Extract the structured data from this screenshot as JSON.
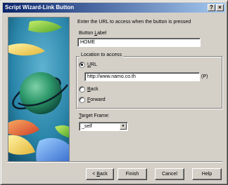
{
  "window": {
    "title": "Script Wizard-Link Button",
    "help_glyph": "?",
    "close_glyph": "×"
  },
  "intro_text": "Enter the URL to access when the button is pressed",
  "button_label": {
    "label_prefix": "Button ",
    "label_accel": "L",
    "label_suffix": "abel",
    "value": "HOME"
  },
  "location": {
    "group_title": "Location to access",
    "url_option": {
      "accel": "U",
      "rest": "RL",
      "selected": true
    },
    "url_value": "http://www.namo.co.th",
    "url_field_suffix": "(P)",
    "back_option": {
      "accel": "B",
      "rest": "ack",
      "selected": false
    },
    "forward_option": {
      "accel": "F",
      "rest": "orward",
      "selected": false
    }
  },
  "target_frame": {
    "label_accel": "T",
    "label_rest": "arget Frame:",
    "value": "_self",
    "arrow_glyph": "▼"
  },
  "buttons": {
    "back": {
      "prefix": "< ",
      "accel": "B",
      "rest": "ack"
    },
    "finish": "Finish",
    "cancel": "Cancel",
    "help": "Help"
  },
  "icons": [
    "help-icon",
    "close-icon",
    "dropdown-arrow-icon",
    "wizard-globe-graphic"
  ]
}
